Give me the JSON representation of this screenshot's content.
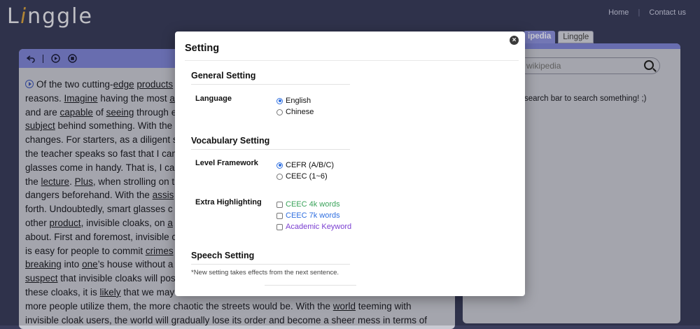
{
  "topbar": {
    "logo_left": "L",
    "logo_slash": "i",
    "logo_right": "nggle",
    "nav": [
      "Home",
      "Contact us"
    ]
  },
  "article": {
    "lines": [
      [
        [
          "Of the two cutting-",
          false
        ],
        [
          "edge",
          true
        ],
        [
          " ",
          false
        ],
        [
          "products",
          true
        ]
      ],
      [
        [
          "reasons. ",
          false
        ],
        [
          "Imagine",
          true
        ],
        [
          " having the most ",
          false
        ],
        [
          "a",
          true
        ]
      ],
      [
        [
          "and are ",
          false
        ],
        [
          "capable",
          true
        ],
        [
          " of ",
          false
        ],
        [
          "seeing",
          true
        ],
        [
          " through e",
          false
        ]
      ],
      [
        [
          "subject",
          true
        ],
        [
          " behind something. With the",
          false
        ]
      ],
      [
        [
          "changes. For starters, as a diligent s",
          false
        ]
      ],
      [
        [
          "the teacher speaks so fast that I can",
          false
        ]
      ],
      [
        [
          "glasses come in handy. That is, I can",
          false
        ]
      ],
      [
        [
          "the ",
          false
        ],
        [
          "lecture",
          true
        ],
        [
          ". ",
          false
        ],
        [
          "Plus",
          true
        ],
        [
          ", when strolling on t",
          false
        ]
      ],
      [
        [
          "dangers beforehand. With the ",
          false
        ],
        [
          "assis",
          true
        ]
      ],
      [
        [
          "forth. Undoubtedly, smart glasses c",
          false
        ]
      ],
      [
        [
          "other ",
          false
        ],
        [
          "product",
          true
        ],
        [
          ", invisible cloaks, on ",
          false
        ],
        [
          "a",
          true
        ]
      ],
      [
        [
          "about. First and foremost, invisible c",
          false
        ]
      ],
      [
        [
          "is easy for people to commit ",
          false
        ],
        [
          "crimes",
          true
        ]
      ],
      [
        [
          "breaking",
          true
        ],
        [
          " into ",
          false
        ],
        [
          "one",
          true
        ],
        [
          "’s house without a",
          false
        ]
      ],
      [
        [
          "suspect",
          true
        ],
        [
          " that invisible cloaks will pos",
          false
        ]
      ],
      [
        [
          "these cloaks, it is ",
          false
        ],
        [
          "likely",
          true
        ],
        [
          " that we may",
          false
        ]
      ],
      [
        [
          "more people utilize them, the more chaotic the streets would be. With the ",
          false
        ],
        [
          "world",
          true
        ],
        [
          " teeming with",
          false
        ]
      ],
      [
        [
          "invisible cloak users, the world will gradually lose its order and become a sheer mess in terms of",
          false
        ]
      ]
    ]
  },
  "wiki": {
    "tabs": [
      "ipedia",
      "Linggle"
    ],
    "search_placeholder": "rch wikipedia",
    "hint": "search bar to search something! ;)"
  },
  "modal": {
    "title": "Setting",
    "close": "×",
    "sections": {
      "general": "General Setting",
      "vocab": "Vocabulary Setting",
      "speech": "Speech Setting"
    },
    "language_label": "Language",
    "language_options": [
      "English",
      "Chinese"
    ],
    "level_label": "Level Framework",
    "level_options": [
      "CEFR (A/B/C)",
      "CEEC (1~6)"
    ],
    "extra_label": "Extra Highlighting",
    "extra_options": [
      "CEEC 4k words",
      "CEEC 7k words",
      "Academic Keyword"
    ],
    "note": "*New setting takes effects from the next sentence."
  },
  "colors": {
    "ceec4k": "#3aa35a",
    "ceec7k": "#2f6fe0",
    "academic": "#7b3fd1"
  }
}
